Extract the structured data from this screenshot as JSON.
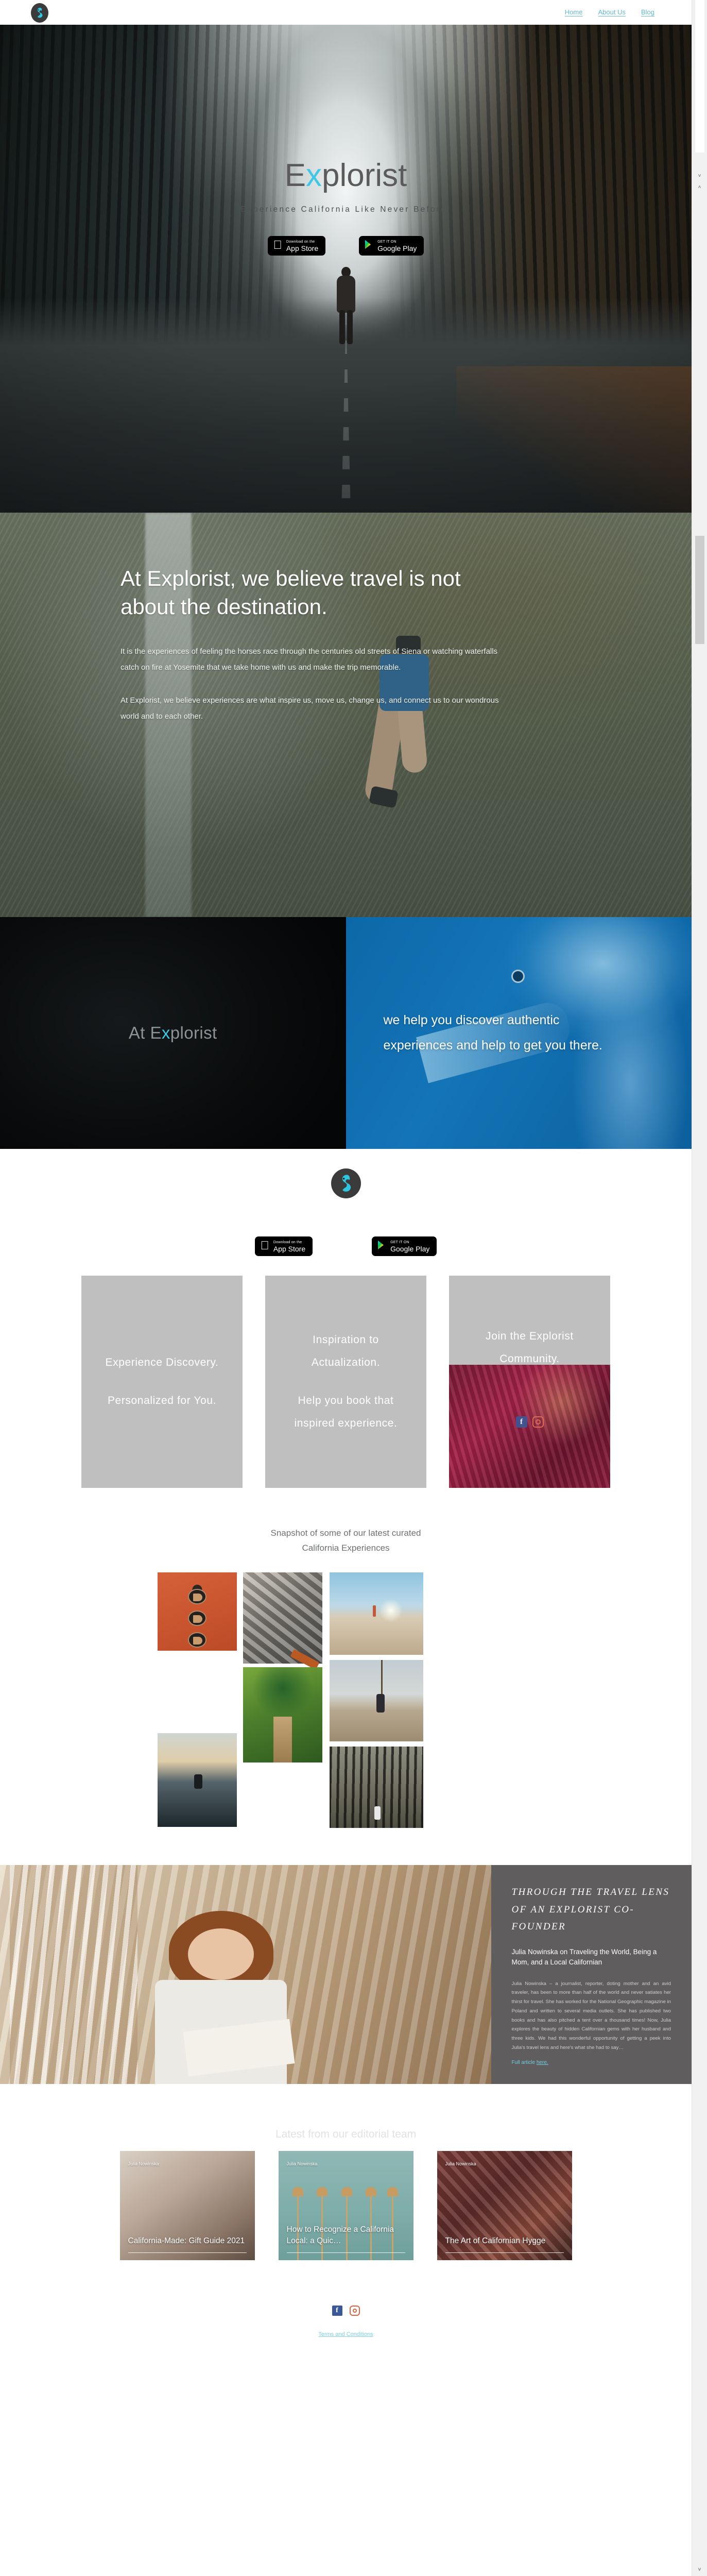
{
  "brand": {
    "name": "Explorist",
    "accent": "#3ec8e6",
    "logo_icon": "explorist-swan-logo"
  },
  "nav": {
    "items": [
      {
        "label": "Home"
      },
      {
        "label": "About Us"
      },
      {
        "label": "Blog"
      }
    ]
  },
  "hero": {
    "title_prefix": "E",
    "title_accent": "x",
    "title_suffix": "plorist",
    "subtitle": "Experience California Like Never Before.",
    "app_store": {
      "small": "Download on the",
      "big": "App Store",
      "icon": "apple-icon"
    },
    "google_play": {
      "small": "GET IT ON",
      "big": "Google Play",
      "icon": "google-play-icon"
    }
  },
  "believe": {
    "heading": "At Explorist, we believe travel is not about the destination.",
    "paragraph1": "It is the experiences of feeling the horses race through the centuries old streets of Siena or watching waterfalls catch on fire at Yosemite that we take home with us and make the trip memorable.",
    "paragraph2": "At Explorist, we believe experiences are what inspire us, move us, change us, and connect us to our wondrous world and to each other."
  },
  "split": {
    "left_prefix": "At E",
    "left_accent": "x",
    "left_suffix": "plorist",
    "right_text": "we help you discover authentic experiences and help to get you there."
  },
  "cards": [
    {
      "line1": "Experience Discovery.",
      "line2": "Personalized for You."
    },
    {
      "line1": "Inspiration to Actualization.",
      "line2": "Help you book that inspired experience."
    },
    {
      "line1": "Join the Explorist Community.",
      "line2": ""
    }
  ],
  "snapshot": {
    "heading_line1": "Snapshot of some of our latest curated",
    "heading_line2": "California Experiences",
    "images": [
      {
        "alt": "fortune-cookies-on-orange"
      },
      {
        "alt": "fresh-oysters-on-ice"
      },
      {
        "alt": "man-standing-on-dry-lakebed"
      },
      {
        "alt": "wooden-bridge-through-green-tunnel"
      },
      {
        "alt": "woman-on-rope-swing-over-bay"
      },
      {
        "alt": "surfer-sitting-on-board-at-dusk"
      },
      {
        "alt": "person-in-tall-redwood-forest"
      }
    ]
  },
  "cofounder": {
    "kicker": "THROUGH THE TRAVEL LENS OF AN EXPLORIST CO-FOUNDER",
    "subtitle": "Julia Nowinska on Traveling the World, Being a Mom, and a Local Californian",
    "body": "Julia Nowinska – a journalist, reporter, doting mother and an avid traveler, has been to more than half of the world and never satiates her thirst for travel. She has worked for the National Geographic magazine in Poland and written to several media outlets. She has published two books and has also pitched a tent over a thousand times! Now, Julia explores the beauty of hidden Californian gems with her husband and three kids. We had this wonderful opportunity of getting a peek into Julia's travel lens and here's what she had to say…",
    "link_prefix": "Full article ",
    "link_label": "here."
  },
  "blog": {
    "heading": "Latest from our editorial team",
    "posts": [
      {
        "author": "Julia Nowinska",
        "title": "California-Made: Gift Guide 2021"
      },
      {
        "author": "Julia Nowinska",
        "title": "How to Recognize a California Local: a Quic…"
      },
      {
        "author": "Julia Nowinska",
        "title": "The Art of Californian Hygge"
      }
    ]
  },
  "footer": {
    "facebook_icon": "facebook-icon",
    "instagram_icon": "instagram-icon",
    "terms_label": "Terms and Conditions"
  },
  "scrollbar": {
    "up_arrow": "˄",
    "down_arrow": "˅",
    "bottom_arrow": "˅"
  }
}
